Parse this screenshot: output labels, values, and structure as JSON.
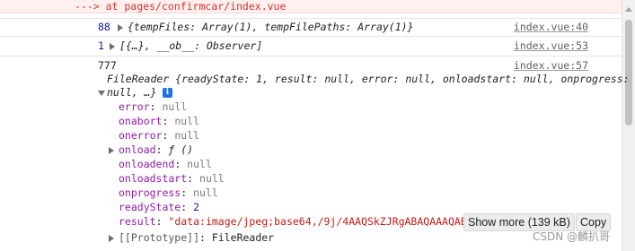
{
  "banner": {
    "text": "---> at pages/confirmcar/index.vue"
  },
  "log_entries": [
    {
      "count": "88",
      "content": "{tempFiles: Array(1), tempFilePaths: Array(1)}",
      "source": "index.vue:40"
    },
    {
      "count": "1",
      "content": "[{…}, __ob__: Observer]",
      "source": "index.vue:53"
    },
    {
      "count": "777",
      "source": "index.vue:57"
    }
  ],
  "filereader": {
    "line1": "FileReader {readyState: 1, result: null, error: null, onloadstart: null, onprogress:",
    "line2": "null, …}",
    "info_icon_glyph": "i",
    "props": [
      {
        "key": "error",
        "value": "null"
      },
      {
        "key": "onabort",
        "value": "null"
      },
      {
        "key": "onerror",
        "value": "null"
      },
      {
        "key": "onload",
        "value": "ƒ ()"
      },
      {
        "key": "onloadend",
        "value": "null"
      },
      {
        "key": "onloadstart",
        "value": "null"
      },
      {
        "key": "onprogress",
        "value": "null"
      },
      {
        "key": "readyState",
        "value": "2"
      },
      {
        "key": "result",
        "value": "\"data:image/jpeg;base64,/9j/4AAQSkZJRgABAQAAAQABAA"
      }
    ],
    "prototype": {
      "key": "[[Prototype]]",
      "value": "FileReader"
    }
  },
  "buttons": {
    "show_more": "Show more (139 kB)",
    "copy": "Copy"
  },
  "watermark": "CSDN @麟扒哥",
  "icons": {
    "expand": "triangle-right-icon",
    "collapse": "triangle-down-icon",
    "info": "info-icon"
  },
  "colors": {
    "property": "#8e1da4",
    "string": "#c41a16",
    "number": "#1a1aa6",
    "error_banner": "#d93025"
  }
}
